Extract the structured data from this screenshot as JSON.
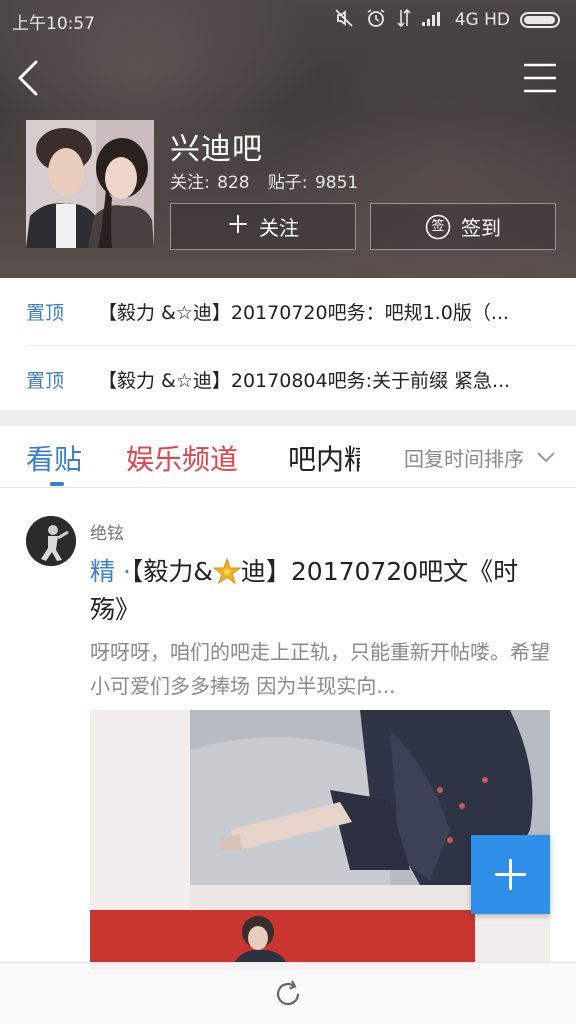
{
  "status_bar": {
    "time": "上午10:57",
    "network": "4G HD"
  },
  "forum": {
    "name": "兴迪吧",
    "followers_label": "关注:",
    "followers": "828",
    "posts_label": "贴子:",
    "posts": "9851",
    "follow_label": "关注",
    "signin_label": "签到",
    "signin_icon_char": "签"
  },
  "pinned": [
    {
      "tag": "置顶",
      "title": "【毅力 &☆迪】20170720吧务：吧规1.0版（..."
    },
    {
      "tag": "置顶",
      "title": "【毅力 &☆迪】20170804吧务:关于前缀 紧急..."
    }
  ],
  "tabs": {
    "kantie": "看贴",
    "yule": "娱乐频道",
    "bana": "吧内精",
    "sort": "回复时间排序"
  },
  "post": {
    "user": "绝铉",
    "badge": "精 ·",
    "title_a": "【毅力&",
    "title_b": "迪】20170720吧文《时殇》",
    "excerpt": "呀呀呀，咱们的吧走上正轨，只能重新开帖喽。希望小可爱们多多捧场 因为半现实向..."
  },
  "colors": {
    "accent_blue": "#3d7fc4",
    "tab_red": "#e0454b",
    "fab_blue": "#2f8ee8"
  }
}
